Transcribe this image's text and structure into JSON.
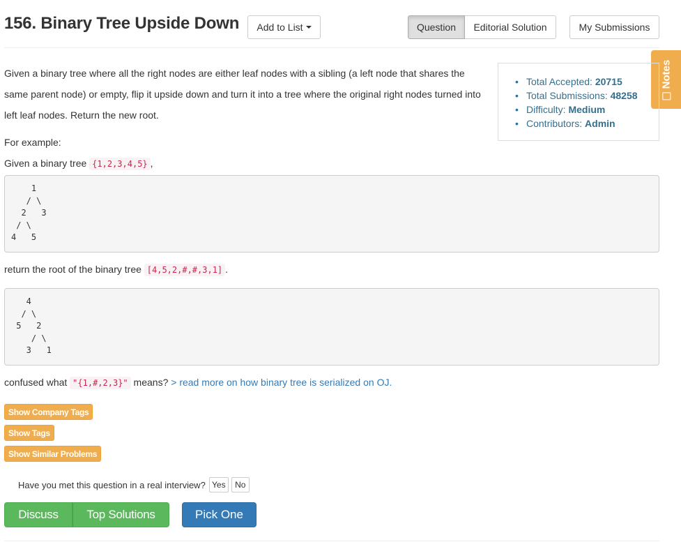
{
  "header": {
    "title": "156. Binary Tree Upside Down",
    "add_to_list": "Add to List",
    "tabs": [
      "Question",
      "Editorial Solution"
    ],
    "my_submissions": "My Submissions"
  },
  "notes": {
    "label": "Notes"
  },
  "description": {
    "paragraph": "Given a binary tree where all the right nodes are either leaf nodes with a sibling (a left node that shares the same parent node) or empty, flip it upside down and turn it into a tree where the original right nodes turned into left leaf nodes. Return the new root.",
    "for_example": "For example:",
    "given_prefix": "Given a binary tree ",
    "given_code": "{1,2,3,4,5}",
    "given_suffix": ",",
    "tree_before": "    1\n   / \\\n  2   3\n / \\\n4   5",
    "return_prefix": "return the root of the binary tree ",
    "return_code": "[4,5,2,#,#,3,1]",
    "return_suffix": ".",
    "tree_after": "   4\n  / \\\n 5   2\n    / \\\n   3   1",
    "confused_prefix": "confused what ",
    "confused_code": "\"{1,#,2,3}\"",
    "confused_suffix": " means? ",
    "read_more_link": "> read more on how binary tree is serialized on OJ."
  },
  "stats": {
    "accepted_label": "Total Accepted: ",
    "accepted_value": "20715",
    "submissions_label": "Total Submissions: ",
    "submissions_value": "48258",
    "difficulty_label": "Difficulty: ",
    "difficulty_value": "Medium",
    "contributors_label": "Contributors: ",
    "contributors_value": "Admin"
  },
  "tag_buttons": {
    "company": "Show Company Tags",
    "tags": "Show Tags",
    "similar": "Show Similar Problems"
  },
  "interview": {
    "question": "Have you met this question in a real interview?",
    "yes": "Yes",
    "no": "No"
  },
  "actions": {
    "discuss": "Discuss",
    "top_solutions": "Top Solutions",
    "pick_one": "Pick One"
  },
  "colors": {
    "orange": "#f0ad4e",
    "green": "#5cb85c",
    "blue": "#337ab7",
    "code_red": "#c7254e",
    "stats_blue": "#31708f"
  }
}
